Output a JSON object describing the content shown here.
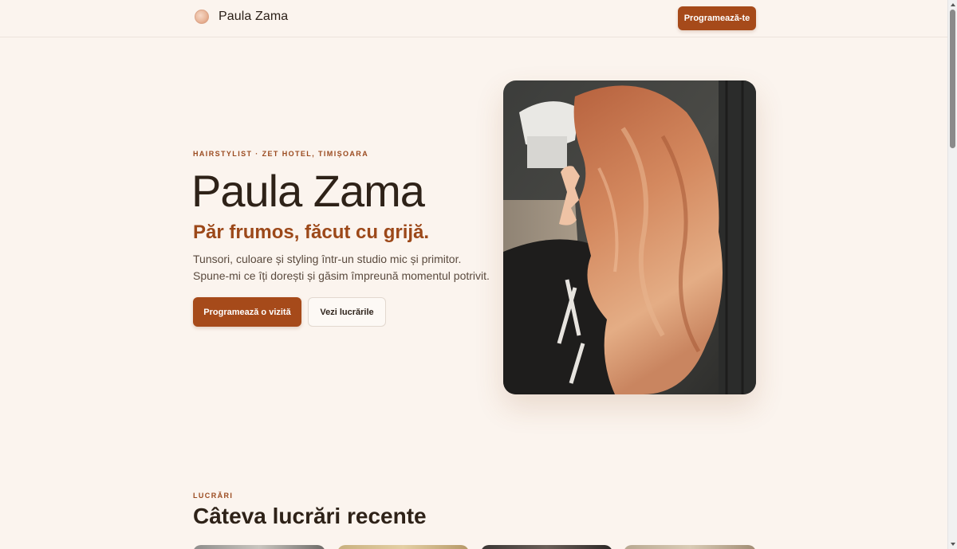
{
  "header": {
    "brand_name": "Paula Zama",
    "cta_label": "Programează-te"
  },
  "hero": {
    "eyebrow": "HAIRSTYLIST · ZET HOTEL, TIMIȘOARA",
    "title": "Paula Zama",
    "tagline": "Păr frumos, făcut cu grijă.",
    "description_line1": "Tunsori, culoare și styling într-un studio mic și primitor.",
    "description_line2": "Spune-mi ce îți dorești și găsim împreună momentul potrivit.",
    "primary_button": "Programează o vizită",
    "secondary_button": "Vezi lucrările"
  },
  "works": {
    "eyebrow": "LUCRĂRI",
    "title": "Câteva lucrări recente"
  },
  "colors": {
    "accent": "#a64a1a",
    "tagline": "#9c4819",
    "background": "#fbf4ee",
    "text": "#2e2218"
  }
}
